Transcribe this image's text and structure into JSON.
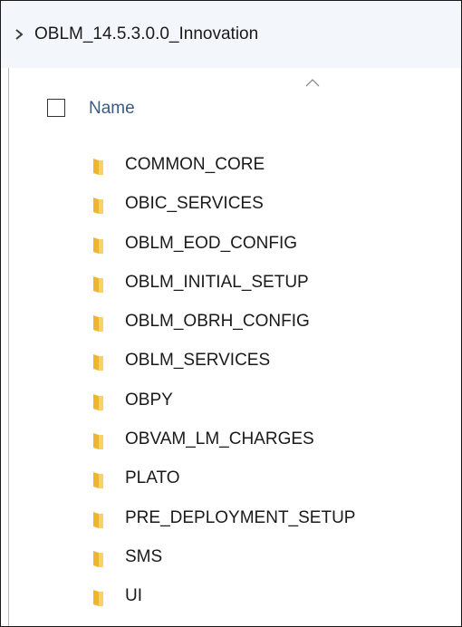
{
  "address_bar": {
    "path": "OBLM_14.5.3.0.0_Innovation"
  },
  "header": {
    "name_column": "Name"
  },
  "items": [
    {
      "name": "COMMON_CORE"
    },
    {
      "name": "OBIC_SERVICES"
    },
    {
      "name": "OBLM_EOD_CONFIG"
    },
    {
      "name": "OBLM_INITIAL_SETUP"
    },
    {
      "name": "OBLM_OBRH_CONFIG"
    },
    {
      "name": "OBLM_SERVICES"
    },
    {
      "name": "OBPY"
    },
    {
      "name": "OBVAM_LM_CHARGES"
    },
    {
      "name": "PLATO"
    },
    {
      "name": "PRE_DEPLOYMENT_SETUP"
    },
    {
      "name": "SMS"
    },
    {
      "name": "UI"
    }
  ],
  "colors": {
    "folder_yellow": "#f5c542",
    "header_blue": "#3a5a86",
    "address_bg": "#f3f7fc"
  }
}
